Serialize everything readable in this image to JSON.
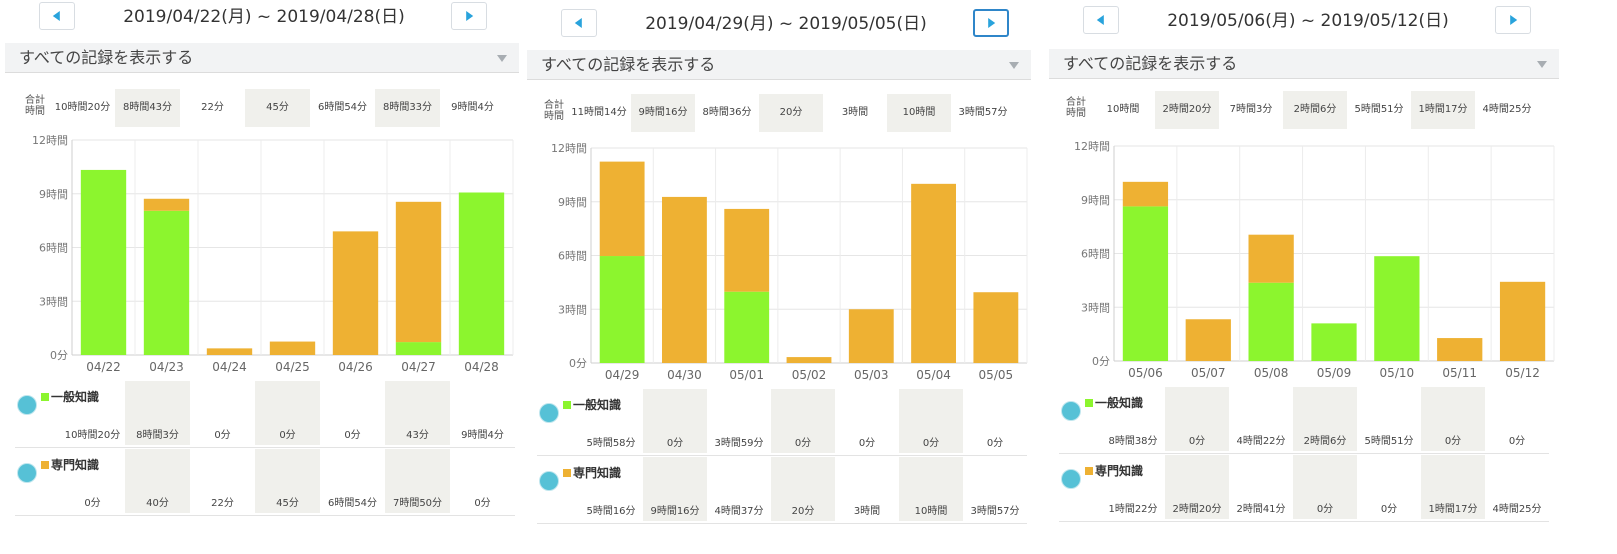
{
  "ui": {
    "dropdown_label": "すべての記録を表示する",
    "totals_label": "合計\n時間",
    "unit": "時間",
    "colors": {
      "general": "#8cf52e",
      "specialized": "#eeb133",
      "nav_accent": "#29a3dc",
      "shade": "#f0f0ec"
    },
    "legend_icon": "user-avatar-icon",
    "panels": [
      {
        "range": "2019/04/22(月) ~ 2019/04/28(日)",
        "totals": [
          "10時間20分",
          "8時間43分",
          "22分",
          "45分",
          "6時間54分",
          "8時間33分",
          "9時間4分"
        ],
        "general_labels": [
          "10時間20分",
          "8時間3分",
          "0分",
          "0分",
          "0分",
          "43分",
          "9時間4分"
        ],
        "specialized_labels": [
          "0分",
          "40分",
          "22分",
          "45分",
          "6時間54分",
          "7時間50分",
          "0分"
        ],
        "next_active": false
      },
      {
        "range": "2019/04/29(月) ~ 2019/05/05(日)",
        "totals": [
          "11時間14分",
          "9時間16分",
          "8時間36分",
          "20分",
          "3時間",
          "10時間",
          "3時間57分"
        ],
        "general_labels": [
          "5時間58分",
          "0分",
          "3時間59分",
          "0分",
          "0分",
          "0分",
          "0分"
        ],
        "specialized_labels": [
          "5時間16分",
          "9時間16分",
          "4時間37分",
          "20分",
          "3時間",
          "10時間",
          "3時間57分"
        ],
        "next_active": true
      },
      {
        "range": "2019/05/06(月) ~ 2019/05/12(日)",
        "totals": [
          "10時間",
          "2時間20分",
          "7時間3分",
          "2時間6分",
          "5時間51分",
          "1時間17分",
          "4時間25分"
        ],
        "general_labels": [
          "8時間38分",
          "0分",
          "4時間22分",
          "2時間6分",
          "5時間51分",
          "0分",
          "0分"
        ],
        "specialized_labels": [
          "1時間22分",
          "2時間20分",
          "2時間41分",
          "0分",
          "0分",
          "1時間17分",
          "4時間25分"
        ],
        "next_active": false
      }
    ]
  },
  "chart_data": [
    {
      "type": "bar",
      "stacked": true,
      "categories": [
        "04/22",
        "04/23",
        "04/24",
        "04/25",
        "04/26",
        "04/27",
        "04/28"
      ],
      "y_ticks": [
        "0分",
        "3時間",
        "6時間",
        "9時間",
        "12時間"
      ],
      "ylim": [
        0,
        12
      ],
      "grid": true,
      "series": [
        {
          "name": "一般知識",
          "color": "#8cf52e",
          "values": [
            10.33,
            8.05,
            0,
            0,
            0,
            0.72,
            9.07
          ]
        },
        {
          "name": "専門知識",
          "color": "#eeb133",
          "values": [
            0,
            0.67,
            0.37,
            0.75,
            6.9,
            7.83,
            0
          ]
        }
      ]
    },
    {
      "type": "bar",
      "stacked": true,
      "categories": [
        "04/29",
        "04/30",
        "05/01",
        "05/02",
        "05/03",
        "05/04",
        "05/05"
      ],
      "y_ticks": [
        "0分",
        "3時間",
        "6時間",
        "9時間",
        "12時間"
      ],
      "ylim": [
        0,
        12
      ],
      "grid": true,
      "series": [
        {
          "name": "一般知識",
          "color": "#8cf52e",
          "values": [
            5.97,
            0,
            3.98,
            0,
            0,
            0,
            0
          ]
        },
        {
          "name": "専門知識",
          "color": "#eeb133",
          "values": [
            5.27,
            9.27,
            4.62,
            0.33,
            3,
            10,
            3.95
          ]
        }
      ]
    },
    {
      "type": "bar",
      "stacked": true,
      "categories": [
        "05/06",
        "05/07",
        "05/08",
        "05/09",
        "05/10",
        "05/11",
        "05/12"
      ],
      "y_ticks": [
        "0分",
        "3時間",
        "6時間",
        "9時間",
        "12時間"
      ],
      "ylim": [
        0,
        12
      ],
      "grid": true,
      "series": [
        {
          "name": "一般知識",
          "color": "#8cf52e",
          "values": [
            8.63,
            0,
            4.37,
            2.1,
            5.85,
            0,
            0
          ]
        },
        {
          "name": "専門知識",
          "color": "#eeb133",
          "values": [
            1.37,
            2.33,
            2.68,
            0,
            0,
            1.28,
            4.42
          ]
        }
      ]
    }
  ]
}
